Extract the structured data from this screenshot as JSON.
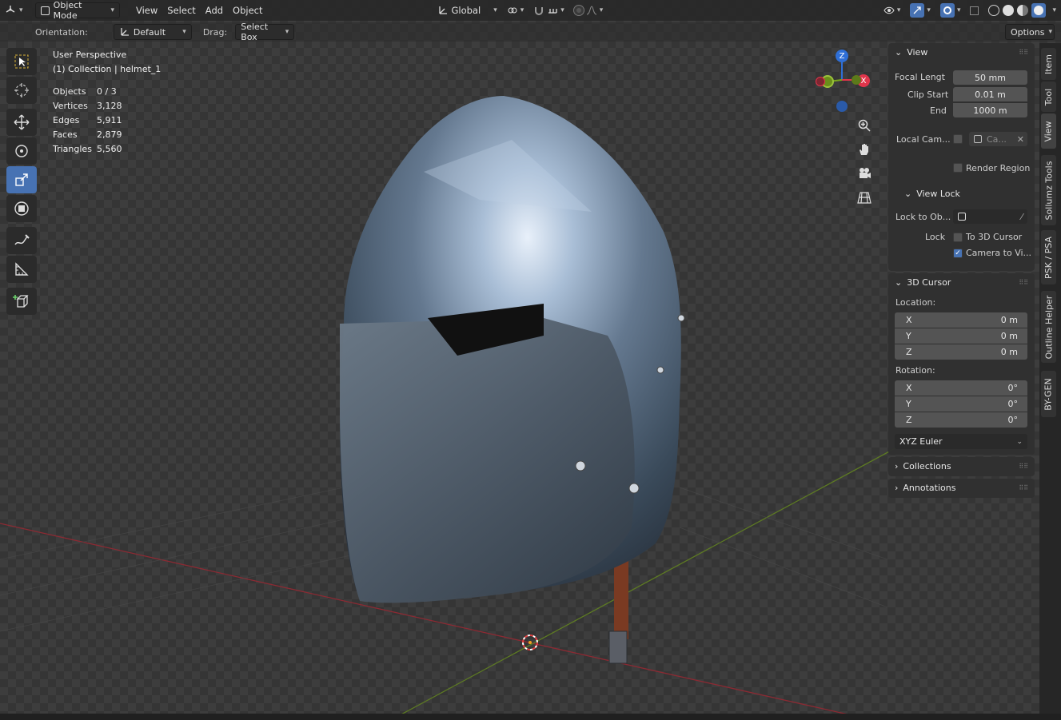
{
  "header": {
    "mode": "Object Mode",
    "menus": [
      "View",
      "Select",
      "Add",
      "Object"
    ],
    "orientation_global": "Global"
  },
  "tool_settings": {
    "orientation_label": "Orientation:",
    "orientation_value": "Default",
    "drag_label": "Drag:",
    "drag_value": "Select Box",
    "options": "Options"
  },
  "overlay": {
    "perspective": "User Perspective",
    "collection": "(1) Collection | helmet_1",
    "stats": [
      {
        "k": "Objects",
        "v": "0 / 3"
      },
      {
        "k": "Vertices",
        "v": "3,128"
      },
      {
        "k": "Edges",
        "v": "5,911"
      },
      {
        "k": "Faces",
        "v": "2,879"
      },
      {
        "k": "Triangles",
        "v": "5,560"
      }
    ]
  },
  "gizmo": {
    "z": "Z",
    "x": "X"
  },
  "npanel": {
    "view": {
      "title": "View",
      "focal_label": "Focal Lengt",
      "focal_value": "50 mm",
      "clip_start_label": "Clip Start",
      "clip_start_value": "0.01 m",
      "end_label": "End",
      "end_value": "1000 m",
      "local_cam_label": "Local Cam...",
      "local_cam_value": "Ca...",
      "render_region": "Render Region",
      "view_lock": "View Lock",
      "lock_to_obj_label": "Lock to Ob...",
      "lock_label": "Lock",
      "to_3d_cursor": "To 3D Cursor",
      "camera_to_view": "Camera to Vi..."
    },
    "cursor": {
      "title": "3D Cursor",
      "location_label": "Location:",
      "loc": [
        {
          "a": "X",
          "v": "0 m"
        },
        {
          "a": "Y",
          "v": "0 m"
        },
        {
          "a": "Z",
          "v": "0 m"
        }
      ],
      "rotation_label": "Rotation:",
      "rot": [
        {
          "a": "X",
          "v": "0°"
        },
        {
          "a": "Y",
          "v": "0°"
        },
        {
          "a": "Z",
          "v": "0°"
        }
      ],
      "rotation_mode": "XYZ Euler"
    },
    "collections": "Collections",
    "annotations": "Annotations"
  },
  "tabs": [
    "Item",
    "Tool",
    "View",
    "Sollumz Tools",
    "PSK / PSA",
    "Outline Helper",
    "BY-GEN"
  ],
  "colors": {
    "accent": "#4772b3",
    "x_axis": "#e0354b",
    "y_axis": "#7aa81e",
    "z_axis": "#2f6fd6"
  }
}
